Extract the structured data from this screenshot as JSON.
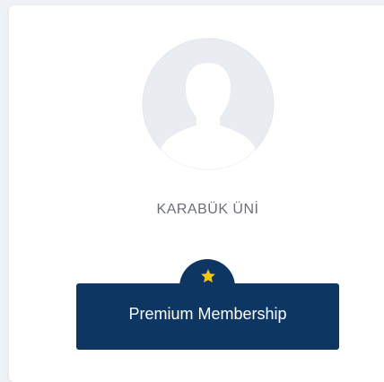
{
  "profile": {
    "avatar_icon": "user-silhouette-icon",
    "organization_name": "KARABÜK ÜNİ"
  },
  "membership": {
    "badge_icon": "star-icon",
    "label": "Premium Membership"
  },
  "colors": {
    "badge_background": "#0e3663",
    "star": "#f5c518",
    "avatar_background": "#e9edf2",
    "avatar_figure": "#ffffff"
  }
}
